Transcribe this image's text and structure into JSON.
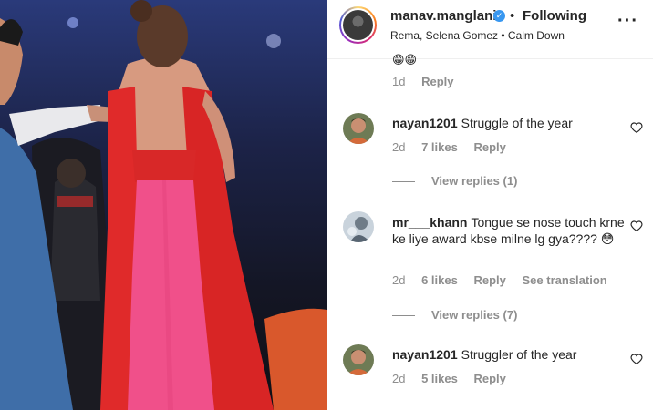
{
  "post": {
    "username": "manav.manglani",
    "separator": "•",
    "follow_label": "Following",
    "subtitle": "Rema, Selena Gomez • Calm Down",
    "more_icon": "more-options-icon"
  },
  "partial_comment": {
    "emojis": "😁😁",
    "time": "1d",
    "reply_label": "Reply"
  },
  "comments": [
    {
      "username": "nayan1201",
      "text": "Struggle of the year",
      "time": "2d",
      "likes": "7 likes",
      "reply_label": "Reply",
      "view_replies": "View replies (1)"
    },
    {
      "username": "mr___khann",
      "text": "Tongue se nose touch krne ke liye award kbse milne lg gya???? 😳",
      "time": "2d",
      "likes": "6 likes",
      "reply_label": "Reply",
      "translate_label": "See translation",
      "view_replies": "View replies (7)"
    },
    {
      "username": "nayan1201",
      "text": "Struggler of the year",
      "time": "2d",
      "likes": "5 likes",
      "reply_label": "Reply"
    }
  ],
  "colors": {
    "text": "#262626",
    "muted": "#8e8e8e",
    "verified": "#3897f0",
    "dress_red": "#e02a2a",
    "dress_pink": "#f0508a"
  }
}
